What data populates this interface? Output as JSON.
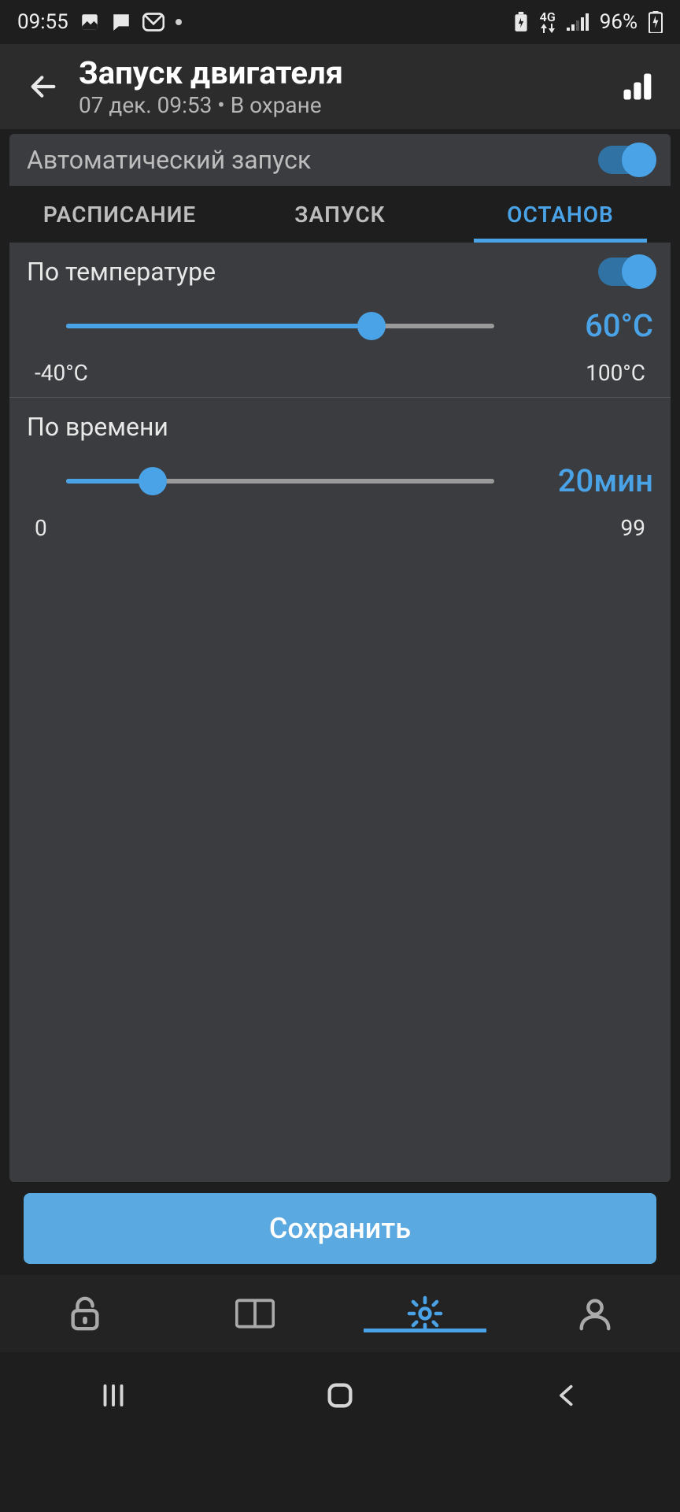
{
  "status_bar": {
    "time": "09:55",
    "network_label": "4G",
    "battery_text": "96%"
  },
  "header": {
    "title": "Запуск двигателя",
    "subtitle": "07 дек. 09:53 • В охране"
  },
  "autostart": {
    "label": "Автоматический запуск",
    "on": true
  },
  "tabs": {
    "schedule": "РАСПИСАНИЕ",
    "start": "ЗАПУСК",
    "stop": "ОСТАНОВ",
    "active": "stop"
  },
  "temperature": {
    "label": "По температуре",
    "on": true,
    "value_display": "60°C",
    "min_label": "-40°C",
    "max_label": "100°C",
    "min": -40,
    "max": 100,
    "value": 60,
    "fill_pct": 71.4
  },
  "time_limit": {
    "label": "По времени",
    "value_display": "20мин",
    "min_label": "0",
    "max_label": "99",
    "min": 0,
    "max": 99,
    "value": 20,
    "fill_pct": 20.2
  },
  "save_label": "Сохранить"
}
